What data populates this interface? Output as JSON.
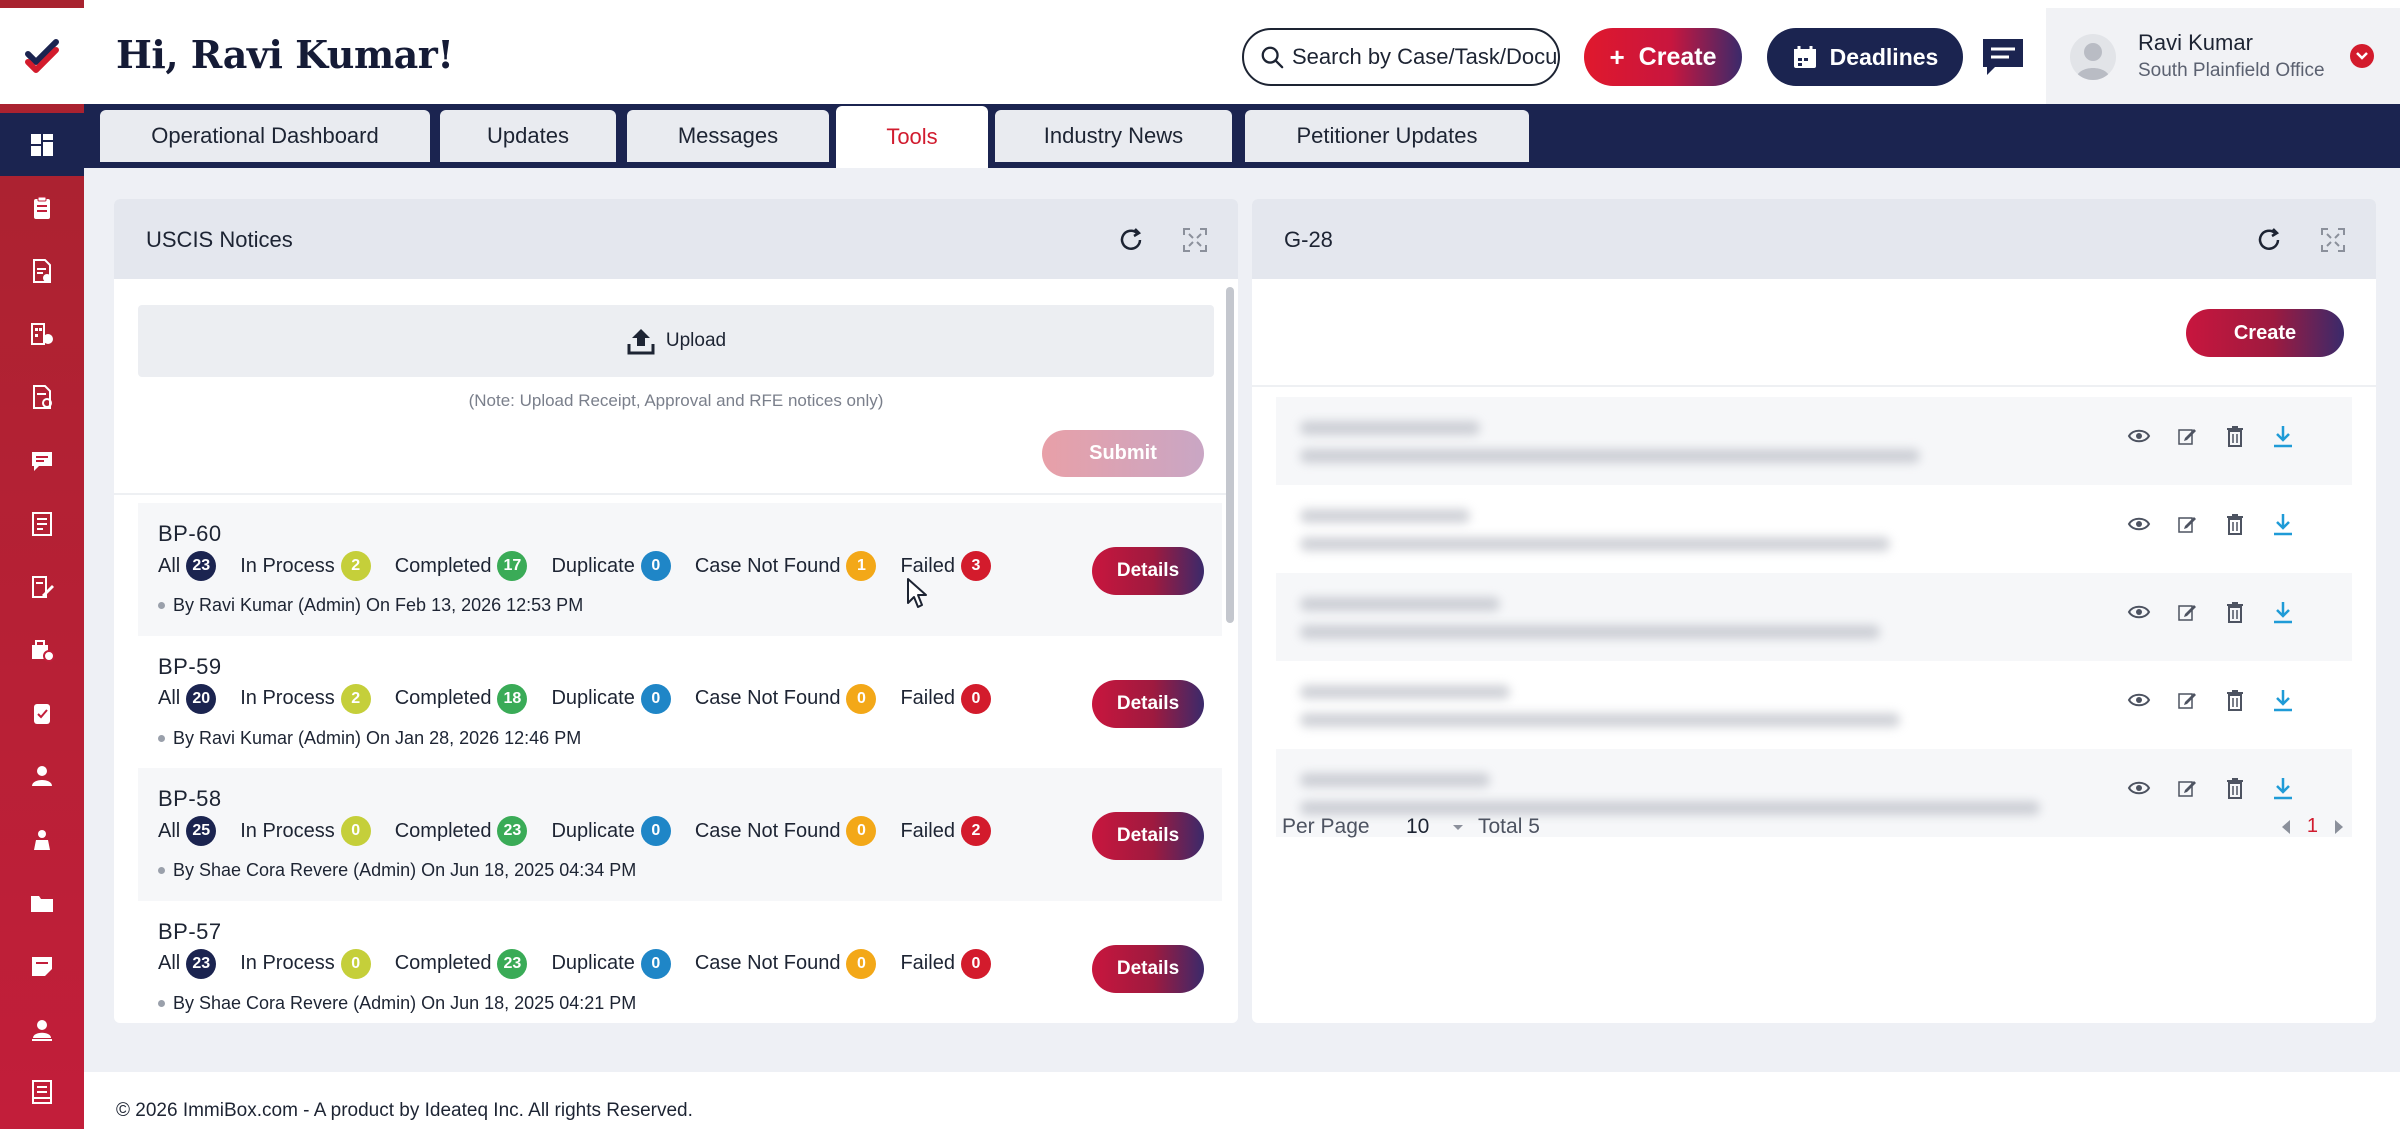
{
  "header": {
    "greeting": "Hi, Ravi Kumar!",
    "search_placeholder": "Search by Case/Task/Document",
    "create_label": "Create",
    "deadlines_label": "Deadlines",
    "user_name": "Ravi Kumar",
    "user_office": "South Plainfield Office"
  },
  "sidebar": {
    "items": [
      {
        "icon": "dashboard-icon",
        "active": true
      },
      {
        "icon": "clipboard-icon"
      },
      {
        "icon": "document-check-icon"
      },
      {
        "icon": "building-icon"
      },
      {
        "icon": "document-settings-icon"
      },
      {
        "icon": "chat-icon"
      },
      {
        "icon": "ledger-icon"
      },
      {
        "icon": "edit-document-icon"
      },
      {
        "icon": "briefcase-icon"
      },
      {
        "icon": "clipboard-list-icon"
      },
      {
        "icon": "user-icon"
      },
      {
        "icon": "team-icon"
      },
      {
        "icon": "folder-icon"
      },
      {
        "icon": "note-icon"
      },
      {
        "icon": "contact-icon"
      },
      {
        "icon": "report-icon"
      }
    ]
  },
  "tabs": [
    {
      "label": "Operational Dashboard",
      "active": false
    },
    {
      "label": "Updates",
      "active": false
    },
    {
      "label": "Messages",
      "active": false
    },
    {
      "label": "Tools",
      "active": true
    },
    {
      "label": "Industry News",
      "active": false
    },
    {
      "label": "Petitioner Updates",
      "active": false
    }
  ],
  "uscis": {
    "title": "USCIS Notices",
    "upload_label": "Upload",
    "note": "(Note: Upload Receipt, Approval and RFE notices only)",
    "submit_label": "Submit",
    "labels": {
      "all": "All",
      "in_process": "In Process",
      "completed": "Completed",
      "duplicate": "Duplicate",
      "case_not_found": "Case Not Found",
      "failed": "Failed",
      "details": "Details"
    },
    "batches": [
      {
        "name": "BP-60",
        "all": "23",
        "in_process": "2",
        "completed": "17",
        "duplicate": "0",
        "case_not_found": "1",
        "failed": "3",
        "meta": "By Ravi Kumar (Admin) On Feb 13, 2026 12:53 PM"
      },
      {
        "name": "BP-59",
        "all": "20",
        "in_process": "2",
        "completed": "18",
        "duplicate": "0",
        "case_not_found": "0",
        "failed": "0",
        "meta": "By Ravi Kumar (Admin) On Jan 28, 2026 12:46 PM"
      },
      {
        "name": "BP-58",
        "all": "25",
        "in_process": "0",
        "completed": "23",
        "duplicate": "0",
        "case_not_found": "0",
        "failed": "2",
        "meta": "By Shae Cora Revere (Admin) On Jun 18, 2025 04:34 PM"
      },
      {
        "name": "BP-57",
        "all": "23",
        "in_process": "0",
        "completed": "23",
        "duplicate": "0",
        "case_not_found": "0",
        "failed": "0",
        "meta": "By Shae Cora Revere (Admin) On Jun 18, 2025 04:21 PM"
      }
    ]
  },
  "g28": {
    "title": "G-28",
    "create_label": "Create",
    "per_page_label": "Per Page",
    "per_page_value": "10",
    "total_label": "Total 5",
    "current_page": "1"
  },
  "footer": {
    "text": "© 2026 ImmiBox.com - A product by Ideateq Inc. All rights Reserved."
  },
  "colors": {
    "brand_red": "#d31b2c",
    "navy": "#1b2450",
    "badge_in_process": "#c5cf3a",
    "badge_completed": "#3aab57",
    "badge_duplicate": "#1f86c7",
    "badge_case_not_found": "#f3a818",
    "badge_failed": "#d31b2c",
    "download_icon": "#1f9bd7"
  }
}
